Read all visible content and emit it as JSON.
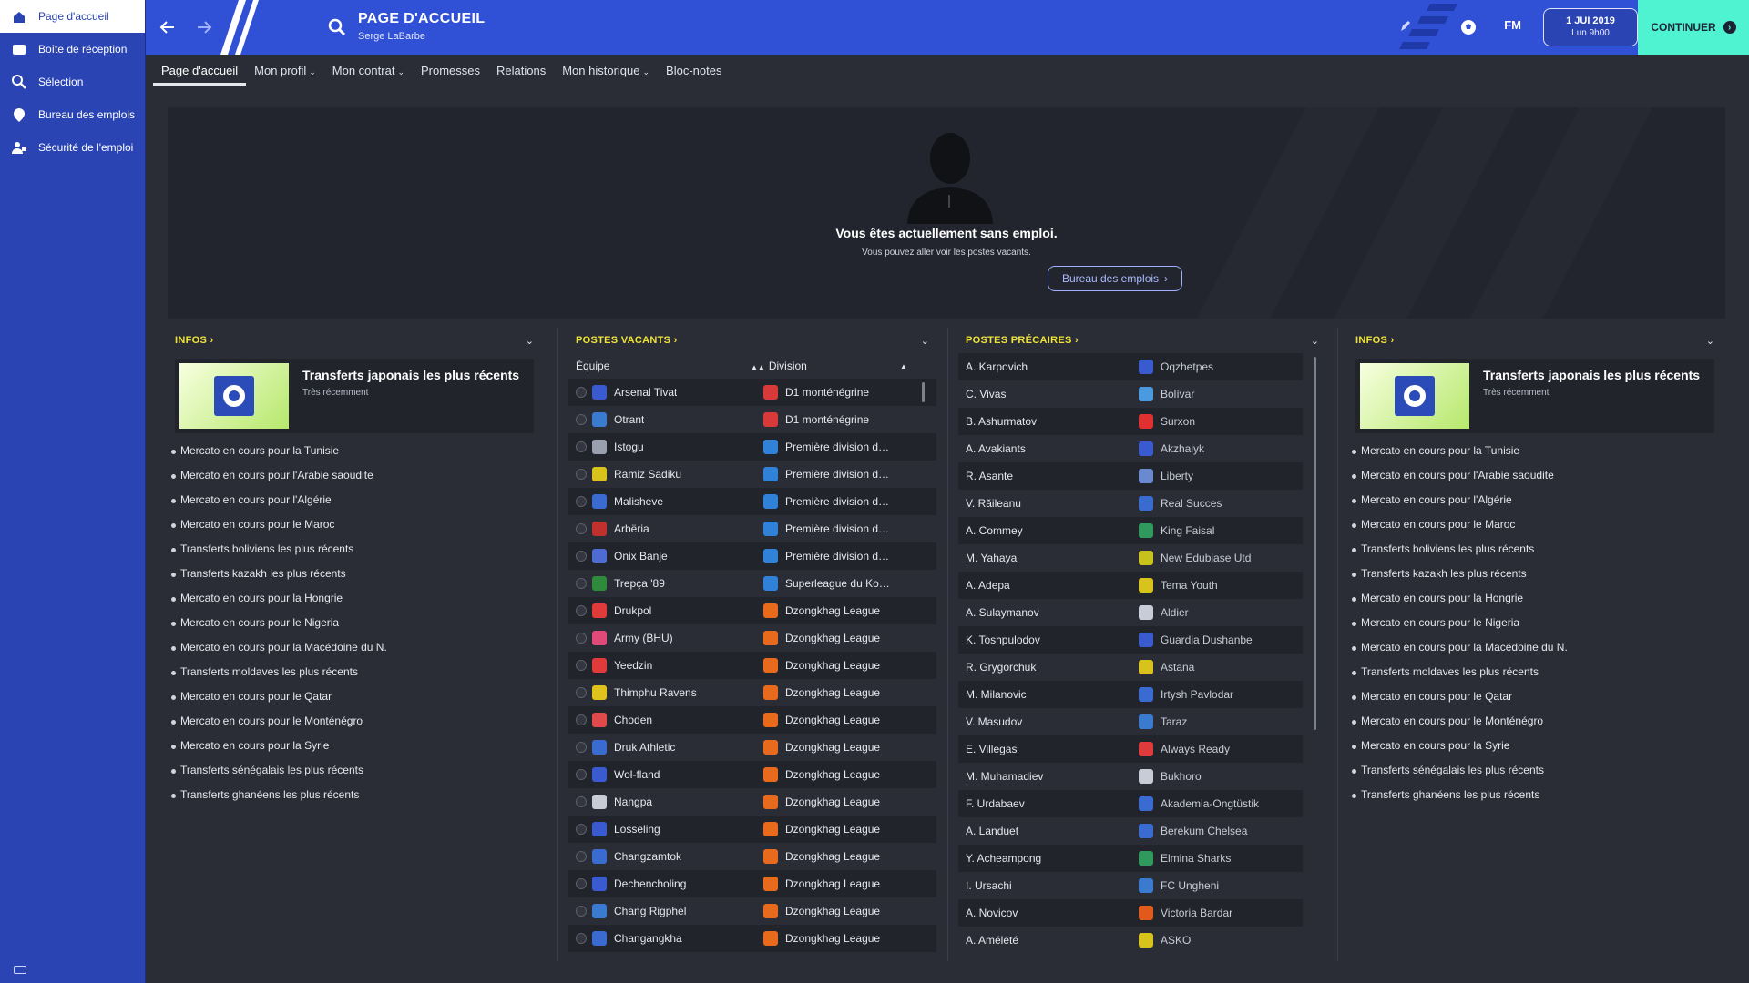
{
  "sidebar": {
    "items": [
      {
        "label": "Page d'accueil",
        "icon": "home-icon",
        "active": true
      },
      {
        "label": "Boîte de réception",
        "icon": "inbox-icon",
        "active": false
      },
      {
        "label": "Sélection",
        "icon": "search-icon",
        "active": false
      },
      {
        "label": "Bureau des emplois",
        "icon": "job-centre-icon",
        "active": false
      },
      {
        "label": "Sécurité de l'emploi",
        "icon": "job-security-icon",
        "active": false
      }
    ]
  },
  "header": {
    "title": "PAGE D'ACCUEIL",
    "subtitle": "Serge LaBarbe",
    "logo": "FM",
    "date": "1 JUI 2019",
    "time": "Lun 9h00",
    "continue_label": "CONTINUER",
    "accent_color": "#3050d6",
    "continue_color": "#4ff2d1"
  },
  "tabs": [
    {
      "label": "Page d'accueil",
      "active": true,
      "dropdown": false
    },
    {
      "label": "Mon profil",
      "active": false,
      "dropdown": true
    },
    {
      "label": "Mon contrat",
      "active": false,
      "dropdown": true
    },
    {
      "label": "Promesses",
      "active": false,
      "dropdown": false
    },
    {
      "label": "Relations",
      "active": false,
      "dropdown": false
    },
    {
      "label": "Mon historique",
      "active": false,
      "dropdown": true
    },
    {
      "label": "Bloc-notes",
      "active": false,
      "dropdown": false
    }
  ],
  "banner": {
    "title": "Vous êtes actuellement sans emploi.",
    "subtitle": "Vous pouvez aller voir les postes vacants.",
    "button_label": "Bureau des emplois"
  },
  "infos_left": {
    "title": "INFOS",
    "card_title": "Transferts japonais les plus récents",
    "card_time": "Très récemment",
    "items": [
      "Mercato en cours pour la Tunisie",
      "Mercato en cours pour l'Arabie saoudite",
      "Mercato en cours pour l'Algérie",
      "Mercato en cours pour le Maroc",
      "Transferts boliviens les plus récents",
      "Transferts kazakh les plus récents",
      "Mercato en cours pour la Hongrie",
      "Mercato en cours pour le Nigeria",
      "Mercato en cours pour la Macédoine du N.",
      "Transferts moldaves les plus récents",
      "Mercato en cours pour le Qatar",
      "Mercato en cours pour le Monténégro",
      "Mercato en cours pour la Syrie",
      "Transferts sénégalais les plus récents",
      "Transferts ghanéens les plus récents"
    ]
  },
  "vacancies": {
    "title": "POSTES VACANTS",
    "col_team": "Équipe",
    "col_division": "Division",
    "rows": [
      {
        "team": "Arsenal Tivat",
        "division": "D1 monténégrine",
        "crest": "#3a5bd0",
        "div_color": "#d83a3a"
      },
      {
        "team": "Otrant",
        "division": "D1 monténégrine",
        "crest": "#3a7bd0",
        "div_color": "#d83a3a"
      },
      {
        "team": "Istogu",
        "division": "Première division d…",
        "crest": "#9aa0ad",
        "div_color": "#2f82d8"
      },
      {
        "team": "Ramiz Sadiku",
        "division": "Première division d…",
        "crest": "#d8c21c",
        "div_color": "#2f82d8"
      },
      {
        "team": "Malisheve",
        "division": "Première division d…",
        "crest": "#3a6bd0",
        "div_color": "#2f82d8"
      },
      {
        "team": "Arbëria",
        "division": "Première division d…",
        "crest": "#c0302f",
        "div_color": "#2f82d8"
      },
      {
        "team": "Onix Banje",
        "division": "Première division d…",
        "crest": "#4d6bd0",
        "div_color": "#2f82d8"
      },
      {
        "team": "Trepça '89",
        "division": "Superleague du Ko…",
        "crest": "#2f8a3c",
        "div_color": "#2f82d8"
      },
      {
        "team": "Drukpol",
        "division": "Dzongkhag League",
        "crest": "#e03a3a",
        "div_color": "#e86a1c"
      },
      {
        "team": "Army (BHU)",
        "division": "Dzongkhag League",
        "crest": "#e04a7a",
        "div_color": "#e86a1c"
      },
      {
        "team": "Yeedzin",
        "division": "Dzongkhag League",
        "crest": "#e03a3a",
        "div_color": "#e86a1c"
      },
      {
        "team": "Thimphu Ravens",
        "division": "Dzongkhag League",
        "crest": "#e0c21c",
        "div_color": "#e86a1c"
      },
      {
        "team": "Choden",
        "division": "Dzongkhag League",
        "crest": "#e04a4a",
        "div_color": "#e86a1c"
      },
      {
        "team": "Druk Athletic",
        "division": "Dzongkhag League",
        "crest": "#3a6bd0",
        "div_color": "#e86a1c"
      },
      {
        "team": "Wol-fland",
        "division": "Dzongkhag League",
        "crest": "#3a5bd0",
        "div_color": "#e86a1c"
      },
      {
        "team": "Nangpa",
        "division": "Dzongkhag League",
        "crest": "#c8ccd6",
        "div_color": "#e86a1c"
      },
      {
        "team": "Losseling",
        "division": "Dzongkhag League",
        "crest": "#3a5bd0",
        "div_color": "#e86a1c"
      },
      {
        "team": "Changzamtok",
        "division": "Dzongkhag League",
        "crest": "#3a6bd0",
        "div_color": "#e86a1c"
      },
      {
        "team": "Dechencholing",
        "division": "Dzongkhag League",
        "crest": "#3a5bd0",
        "div_color": "#e86a1c"
      },
      {
        "team": "Chang Rigphel",
        "division": "Dzongkhag League",
        "crest": "#3a7bd0",
        "div_color": "#e86a1c"
      },
      {
        "team": "Changangkha",
        "division": "Dzongkhag League",
        "crest": "#3a6bd0",
        "div_color": "#e86a1c"
      }
    ]
  },
  "insecure": {
    "title": "POSTES PRÉCAIRES",
    "rows": [
      {
        "name": "A. Karpovich",
        "club": "Oqzhetpes",
        "crest": "#3a5bd0"
      },
      {
        "name": "C. Vivas",
        "club": "Bolívar",
        "crest": "#4a9ae0"
      },
      {
        "name": "B. Ashurmatov",
        "club": "Surxon",
        "crest": "#e03030"
      },
      {
        "name": "A. Avakiants",
        "club": "Akzhaiyk",
        "crest": "#3a5bd0"
      },
      {
        "name": "R. Asante",
        "club": "Liberty",
        "crest": "#6a8ad0"
      },
      {
        "name": "V. Răileanu",
        "club": "Real Succes",
        "crest": "#3a6bd0"
      },
      {
        "name": "A. Commey",
        "club": "King Faisal",
        "crest": "#2f9a5c"
      },
      {
        "name": "M. Yahaya",
        "club": "New Edubiase Utd",
        "crest": "#c8c21c"
      },
      {
        "name": "A. Adepa",
        "club": "Tema Youth",
        "crest": "#d8c21c"
      },
      {
        "name": "A. Sulaymanov",
        "club": "Aldier",
        "crest": "#c8ccd6"
      },
      {
        "name": "K. Toshpulodov",
        "club": "Guardia Dushanbe",
        "crest": "#3a5bd0"
      },
      {
        "name": "R. Grygorchuk",
        "club": "Astana",
        "crest": "#d8c21c"
      },
      {
        "name": "M. Milanovic",
        "club": "Irtysh Pavlodar",
        "crest": "#3a6bd0"
      },
      {
        "name": "V. Masudov",
        "club": "Taraz",
        "crest": "#3a7bd0"
      },
      {
        "name": "E. Villegas",
        "club": "Always Ready",
        "crest": "#e03a3a"
      },
      {
        "name": "M. Muhamadiev",
        "club": "Bukhoro",
        "crest": "#c8ccd6"
      },
      {
        "name": "F. Urdabaev",
        "club": "Akademia-Ongtüstik",
        "crest": "#3a6bd0"
      },
      {
        "name": "A. Landuet",
        "club": "Berekum Chelsea",
        "crest": "#3a6bd0"
      },
      {
        "name": "Y. Acheampong",
        "club": "Elmina Sharks",
        "crest": "#2f9a5c"
      },
      {
        "name": "I. Ursachi",
        "club": "FC Ungheni",
        "crest": "#3a7bd0"
      },
      {
        "name": "A. Novicov",
        "club": "Victoria Bardar",
        "crest": "#e05a1c"
      },
      {
        "name": "A. Amélété",
        "club": "ASKO",
        "crest": "#d8c21c"
      }
    ]
  },
  "infos_right": {
    "title": "INFOS",
    "card_title": "Transferts japonais les plus récents",
    "card_time": "Très récemment",
    "items": [
      "Mercato en cours pour la Tunisie",
      "Mercato en cours pour l'Arabie saoudite",
      "Mercato en cours pour l'Algérie",
      "Mercato en cours pour le Maroc",
      "Transferts boliviens les plus récents",
      "Transferts kazakh les plus récents",
      "Mercato en cours pour la Hongrie",
      "Mercato en cours pour le Nigeria",
      "Mercato en cours pour la Macédoine du N.",
      "Transferts moldaves les plus récents",
      "Mercato en cours pour le Qatar",
      "Mercato en cours pour le Monténégro",
      "Mercato en cours pour la Syrie",
      "Transferts sénégalais les plus récents",
      "Transferts ghanéens les plus récents"
    ]
  }
}
